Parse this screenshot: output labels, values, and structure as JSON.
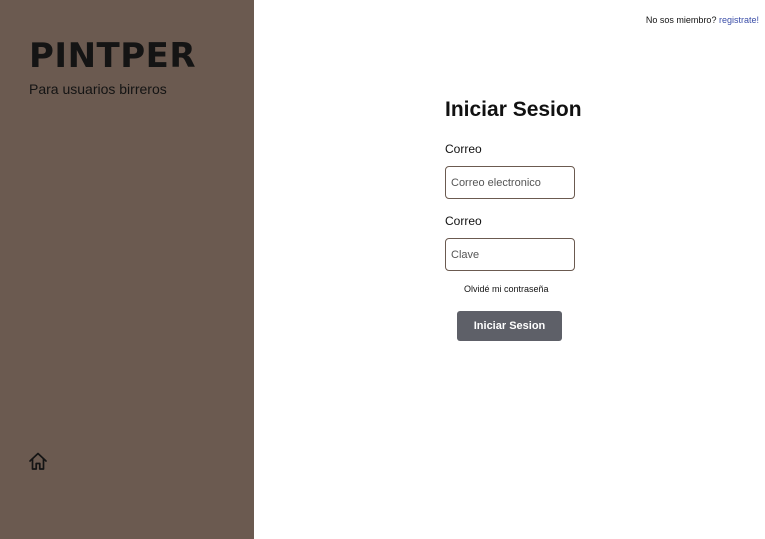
{
  "sidebar": {
    "brand": "PINTPER",
    "tagline": "Para usuarios birreros",
    "home_icon": "home-icon",
    "background_color": "#6b5a50"
  },
  "topbar": {
    "prompt": "No sos miembro?",
    "register_link": "registrate!"
  },
  "login": {
    "title": "Iniciar Sesion",
    "email_label": "Correo",
    "email_placeholder": "Correo electronico",
    "password_label": "Correo",
    "password_placeholder": "Clave",
    "forgot_link": "Olvidé mi contraseña",
    "submit_label": "Iniciar Sesion",
    "submit_color": "#5e6068",
    "link_color": "#3b4ea8"
  }
}
